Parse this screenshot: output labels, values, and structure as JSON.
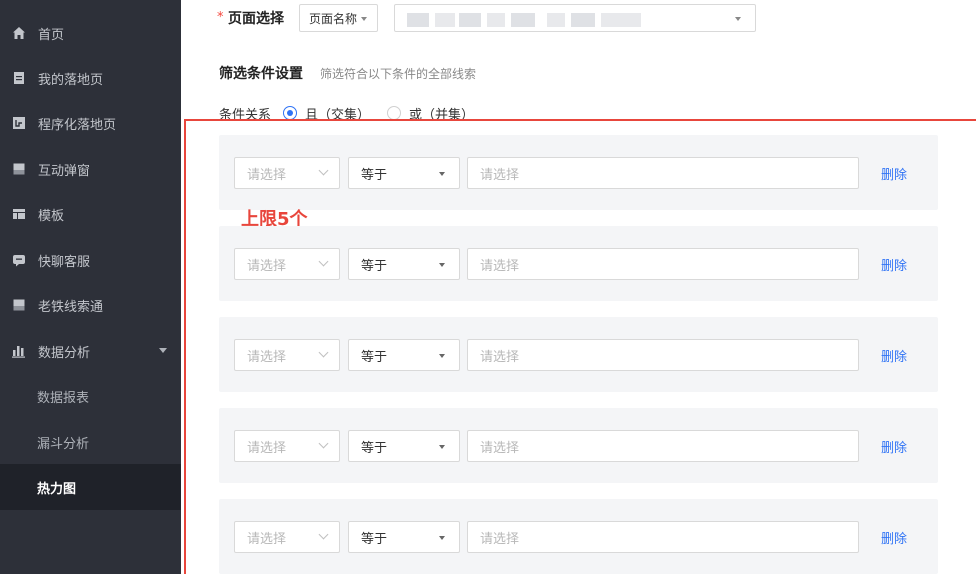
{
  "sidebar": {
    "items": [
      {
        "label": "首页",
        "icon": "home-icon"
      },
      {
        "label": "我的落地页",
        "icon": "document-icon"
      },
      {
        "label": "程序化落地页",
        "icon": "program-icon"
      },
      {
        "label": "互动弹窗",
        "icon": "popup-icon"
      },
      {
        "label": "模板",
        "icon": "template-icon"
      },
      {
        "label": "快聊客服",
        "icon": "chat-icon"
      },
      {
        "label": "老铁线索通",
        "icon": "lead-icon"
      },
      {
        "label": "数据分析",
        "icon": "chart-icon"
      }
    ],
    "sub_items": [
      {
        "label": "数据报表"
      },
      {
        "label": "漏斗分析"
      },
      {
        "label": "热力图",
        "active": true
      }
    ]
  },
  "page_select": {
    "required_mark": "*",
    "label": "页面选择",
    "type_value": "页面名称"
  },
  "filter": {
    "title": "筛选条件设置",
    "subtitle": "筛选符合以下条件的全部线索",
    "relation_label": "条件关系",
    "option_and": "且（交集）",
    "option_or": "或（并集）",
    "selected": "and"
  },
  "annotation": "上限5个",
  "conditions": [
    {
      "field_placeholder": "请选择",
      "operator": "等于",
      "value_placeholder": "请选择",
      "delete_label": "删除"
    },
    {
      "field_placeholder": "请选择",
      "operator": "等于",
      "value_placeholder": "请选择",
      "delete_label": "删除"
    },
    {
      "field_placeholder": "请选择",
      "operator": "等于",
      "value_placeholder": "请选择",
      "delete_label": "删除"
    },
    {
      "field_placeholder": "请选择",
      "operator": "等于",
      "value_placeholder": "请选择",
      "delete_label": "删除"
    },
    {
      "field_placeholder": "请选择",
      "operator": "等于",
      "value_placeholder": "请选择",
      "delete_label": "删除"
    }
  ],
  "colors": {
    "sidebar_bg": "#2d3039",
    "accent": "#2f73f5",
    "annotation_red": "#e8463c"
  }
}
